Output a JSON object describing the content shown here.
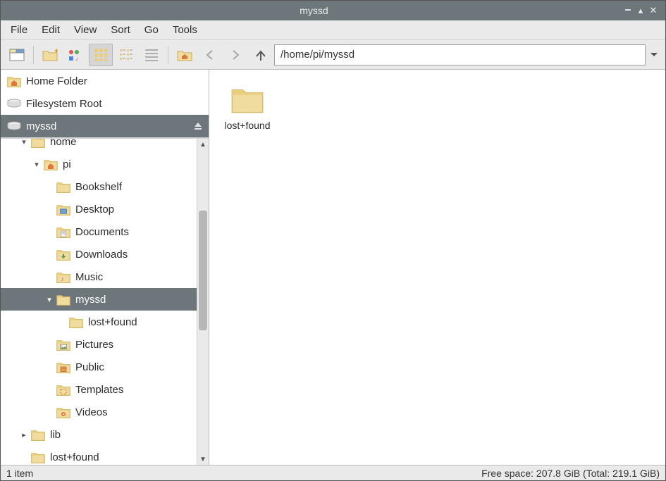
{
  "window": {
    "title": "myssd"
  },
  "menu": [
    "File",
    "Edit",
    "View",
    "Sort",
    "Go",
    "Tools"
  ],
  "path": {
    "value": "/home/pi/myssd"
  },
  "places": [
    {
      "label": "Home Folder",
      "icon": "home-folder",
      "selected": false,
      "eject": false
    },
    {
      "label": "Filesystem Root",
      "icon": "drive",
      "selected": false,
      "eject": false
    },
    {
      "label": "myssd",
      "icon": "drive",
      "selected": true,
      "eject": true
    }
  ],
  "tree": [
    {
      "label": "home",
      "depth": 1,
      "expander": "▾",
      "icon": "folder",
      "selected": false,
      "cut": true
    },
    {
      "label": "pi",
      "depth": 2,
      "expander": "▾",
      "icon": "home-folder",
      "selected": false
    },
    {
      "label": "Bookshelf",
      "depth": 3,
      "expander": "",
      "icon": "folder",
      "selected": false
    },
    {
      "label": "Desktop",
      "depth": 3,
      "expander": "",
      "icon": "desktop-folder",
      "selected": false
    },
    {
      "label": "Documents",
      "depth": 3,
      "expander": "",
      "icon": "docs-folder",
      "selected": false
    },
    {
      "label": "Downloads",
      "depth": 3,
      "expander": "",
      "icon": "downloads-folder",
      "selected": false
    },
    {
      "label": "Music",
      "depth": 3,
      "expander": "",
      "icon": "music-folder",
      "selected": false
    },
    {
      "label": "myssd",
      "depth": 3,
      "expander": "▾",
      "icon": "folder",
      "selected": true
    },
    {
      "label": "lost+found",
      "depth": 4,
      "expander": "",
      "icon": "folder",
      "selected": false
    },
    {
      "label": "Pictures",
      "depth": 3,
      "expander": "",
      "icon": "pictures-folder",
      "selected": false
    },
    {
      "label": "Public",
      "depth": 3,
      "expander": "",
      "icon": "public-folder",
      "selected": false
    },
    {
      "label": "Templates",
      "depth": 3,
      "expander": "",
      "icon": "templates-folder",
      "selected": false
    },
    {
      "label": "Videos",
      "depth": 3,
      "expander": "",
      "icon": "videos-folder",
      "selected": false
    },
    {
      "label": "lib",
      "depth": 1,
      "expander": "▸",
      "icon": "folder",
      "selected": false
    },
    {
      "label": "lost+found",
      "depth": 1,
      "expander": "",
      "icon": "folder",
      "selected": false,
      "cut": true
    }
  ],
  "content": {
    "items": [
      {
        "label": "lost+found",
        "icon": "folder-large"
      }
    ]
  },
  "status": {
    "left": "1 item",
    "right": "Free space: 207.8 GiB (Total: 219.1 GiB)"
  }
}
